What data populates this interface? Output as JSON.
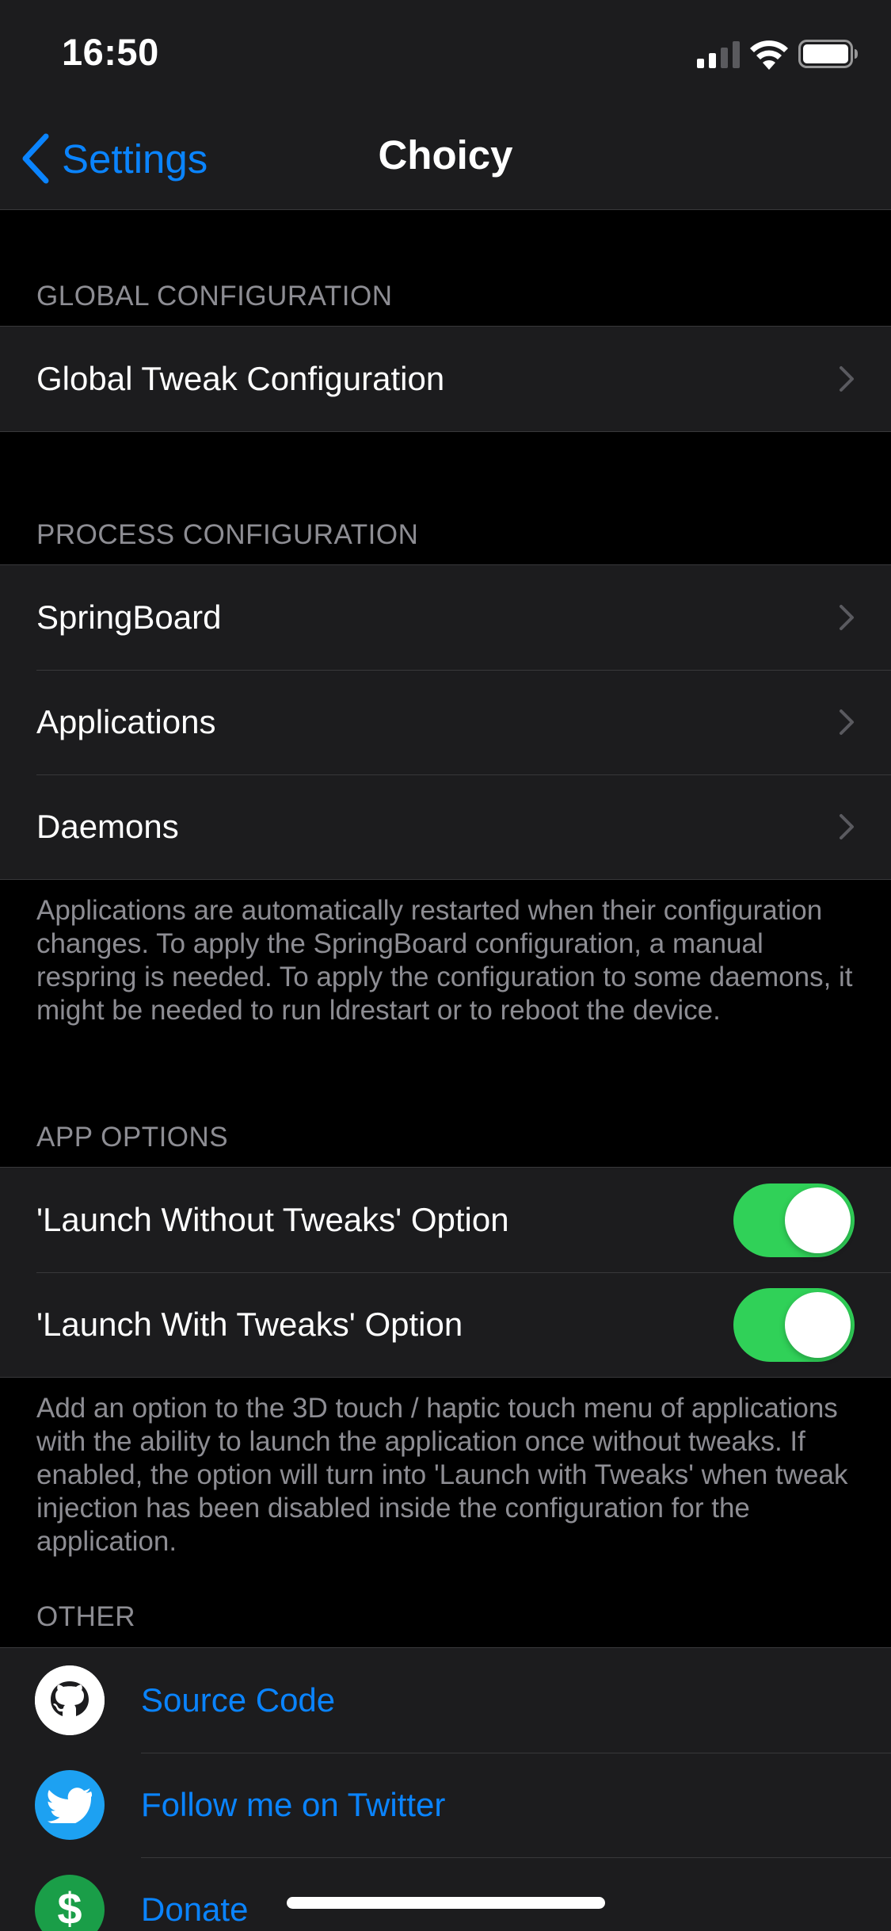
{
  "status_bar": {
    "time": "16:50"
  },
  "nav": {
    "back_label": "Settings",
    "title": "Choicy"
  },
  "sections": {
    "global": {
      "header": "GLOBAL CONFIGURATION",
      "items": [
        {
          "label": "Global Tweak Configuration"
        }
      ]
    },
    "process": {
      "header": "PROCESS CONFIGURATION",
      "items": [
        {
          "label": "SpringBoard"
        },
        {
          "label": "Applications"
        },
        {
          "label": "Daemons"
        }
      ],
      "footer": "Applications are automatically restarted when their configuration changes. To apply the SpringBoard configuration, a manual respring is needed. To apply the configuration to some daemons, it might be needed to run ldrestart or to reboot the device."
    },
    "app_options": {
      "header": "APP OPTIONS",
      "items": [
        {
          "label": "'Launch Without Tweaks' Option",
          "enabled": true
        },
        {
          "label": "'Launch With Tweaks' Option",
          "enabled": true
        }
      ],
      "footer": "Add an option to the 3D touch / haptic touch menu of applications with the ability to launch the application once without tweaks. If enabled, the option will turn into 'Launch with Tweaks' when tweak injection has been disabled inside the configuration for the application."
    },
    "other": {
      "header": "OTHER",
      "items": [
        {
          "label": "Source Code",
          "icon": "github-icon",
          "icon_color": "#ffffff"
        },
        {
          "label": "Follow me on Twitter",
          "icon": "twitter-icon",
          "icon_color": "#1da1f2"
        },
        {
          "label": "Donate",
          "icon": "dollar-icon",
          "icon_color": "#1a9e48"
        }
      ]
    }
  },
  "colors": {
    "accent": "#0a84ff",
    "toggle_on": "#30d158",
    "background": "#000000",
    "cell_background": "#1c1c1e",
    "secondary_text": "#8d8d93"
  }
}
